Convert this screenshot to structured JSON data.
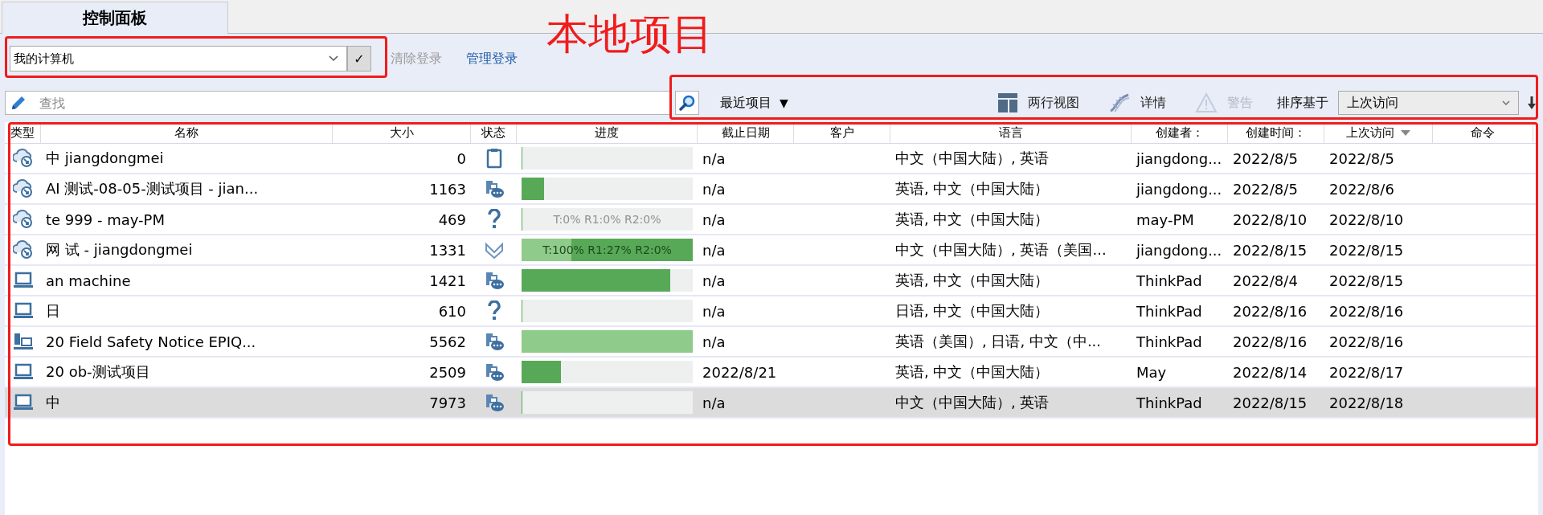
{
  "tabs": [
    {
      "label": "控制面板",
      "selected": true
    }
  ],
  "annotation": {
    "label": "本地项目"
  },
  "location": {
    "value": "我的计算机",
    "confirm": "✓"
  },
  "links": [
    {
      "label": "清除登录",
      "disabled": true
    },
    {
      "label": "管理登录",
      "disabled": false
    }
  ],
  "search": {
    "placeholder": "查找"
  },
  "filter": {
    "label": "最近项目",
    "caret": "▼"
  },
  "toolbar": [
    {
      "kind": "layout",
      "label": "两行视图",
      "disabled": false
    },
    {
      "kind": "dna",
      "label": "详情",
      "disabled": false
    },
    {
      "kind": "warning",
      "label": "警告",
      "disabled": true
    }
  ],
  "sort": {
    "label": "排序基于",
    "value": "上次访问"
  },
  "table": {
    "columns": [
      {
        "label": "类型",
        "sorted": false
      },
      {
        "label": "名称",
        "sorted": false
      },
      {
        "label": "大小",
        "sorted": false
      },
      {
        "label": "状态",
        "sorted": false
      },
      {
        "label": "进度",
        "sorted": false
      },
      {
        "label": "截止日期",
        "sorted": false
      },
      {
        "label": "客户",
        "sorted": false
      },
      {
        "label": "语言",
        "sorted": false
      },
      {
        "label": "创建者：",
        "sorted": false
      },
      {
        "label": "创建时间：",
        "sorted": false
      },
      {
        "label": "上次访问",
        "sorted": true
      },
      {
        "label": "命令",
        "sorted": false
      }
    ],
    "rows": [
      {
        "type": {
          "kind": "cloud"
        },
        "name": "中 jiangdongmei",
        "size": "0",
        "status": {
          "kind": "clipboard"
        },
        "progress": [
          {
            "kind": "dark",
            "level": 0
          }
        ],
        "progress_text": "",
        "due": "n/a",
        "language": "中文（中国大陆）, 英语",
        "creator": "jiangdong...",
        "created": "2022/8/5",
        "last_access": "2022/8/5",
        "selected": false
      },
      {
        "type": {
          "kind": "cloud"
        },
        "name": "AI 测试-08-05-测试项目 - jian...",
        "size": "1163",
        "status": {
          "kind": "sync"
        },
        "progress": [
          {
            "kind": "dark",
            "level": 0.13
          }
        ],
        "progress_text": "",
        "due": "n/a",
        "language": "英语, 中文（中国大陆）",
        "creator": "jiangdong...",
        "created": "2022/8/5",
        "last_access": "2022/8/6",
        "selected": false
      },
      {
        "type": {
          "kind": "cloud"
        },
        "name": "te 999 - may-PM",
        "size": "469",
        "status": {
          "kind": "question"
        },
        "progress": [
          {
            "kind": "dark",
            "level": 0
          }
        ],
        "progress_text": "T:0% R1:0% R2:0%",
        "due": "n/a",
        "language": "英语, 中文（中国大陆）",
        "creator": "may-PM",
        "created": "2022/8/10",
        "last_access": "2022/8/10",
        "selected": false
      },
      {
        "type": {
          "kind": "cloud"
        },
        "name": "网 试 - jiangdongmei",
        "size": "1331",
        "status": {
          "kind": "check"
        },
        "progress": [
          {
            "kind": "dark",
            "level": 1
          },
          {
            "kind": "light",
            "level": 0.29
          }
        ],
        "progress_text": "T:100% R1:27% R2:0%",
        "due": "n/a",
        "language": "中文（中国大陆）, 英语（美国...",
        "creator": "jiangdong...",
        "created": "2022/8/15",
        "last_access": "2022/8/15",
        "selected": false
      },
      {
        "type": {
          "kind": "laptop"
        },
        "name": "an machine",
        "size": "1421",
        "status": {
          "kind": "sync"
        },
        "progress": [
          {
            "kind": "dark",
            "level": 0.87
          }
        ],
        "progress_text": "",
        "due": "n/a",
        "language": "英语, 中文（中国大陆）",
        "creator": "ThinkPad",
        "created": "2022/8/4",
        "last_access": "2022/8/15",
        "selected": false
      },
      {
        "type": {
          "kind": "laptop"
        },
        "name": "日",
        "size": "610",
        "status": {
          "kind": "question"
        },
        "progress": [
          {
            "kind": "dark",
            "level": 0
          }
        ],
        "progress_text": "",
        "due": "n/a",
        "language": "日语, 中文（中国大陆）",
        "creator": "ThinkPad",
        "created": "2022/8/16",
        "last_access": "2022/8/16",
        "selected": false
      },
      {
        "type": {
          "kind": "server"
        },
        "name": "20 Field Safety Notice EPIQ...",
        "size": "5562",
        "status": {
          "kind": "sync"
        },
        "progress": [
          {
            "kind": "light",
            "level": 1
          }
        ],
        "progress_text": "",
        "due": "n/a",
        "language": "英语（美国）, 日语, 中文（中...",
        "creator": "ThinkPad",
        "created": "2022/8/16",
        "last_access": "2022/8/16",
        "selected": false
      },
      {
        "type": {
          "kind": "laptop"
        },
        "name": "20 ob-测试项目",
        "size": "2509",
        "status": {
          "kind": "sync"
        },
        "progress": [
          {
            "kind": "dark",
            "level": 0.23
          }
        ],
        "progress_text": "",
        "due": "2022/8/21",
        "language": "英语, 中文（中国大陆）",
        "creator": "May",
        "created": "2022/8/14",
        "last_access": "2022/8/17",
        "selected": false
      },
      {
        "type": {
          "kind": "laptop"
        },
        "name": "中",
        "size": "7973",
        "status": {
          "kind": "sync"
        },
        "progress": [
          {
            "kind": "dark",
            "level": 0.006
          }
        ],
        "progress_text": "",
        "due": "n/a",
        "language": "中文（中国大陆）, 英语",
        "creator": "ThinkPad",
        "created": "2022/8/15",
        "last_access": "2022/8/18",
        "selected": true
      }
    ]
  }
}
